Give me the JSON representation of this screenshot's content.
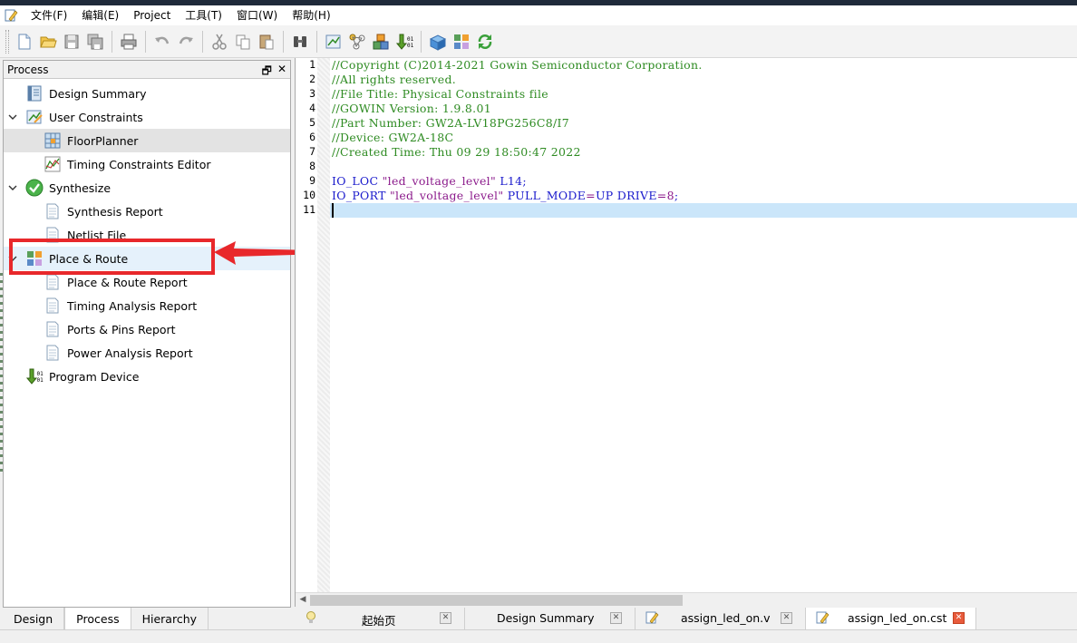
{
  "menu": {
    "items": [
      "文件(F)",
      "编辑(E)",
      "Project",
      "工具(T)",
      "窗口(W)",
      "帮助(H)"
    ]
  },
  "toolbar": {
    "buttons": [
      "new-file-icon",
      "open-folder-icon",
      "save-icon",
      "save-all-icon",
      "print-icon",
      "undo-icon",
      "redo-icon",
      "cut-icon",
      "copy-icon",
      "paste-icon",
      "find-icon",
      "constraints-icon",
      "netlist-icon",
      "synthesize-icon",
      "program-icon",
      "run-all-icon",
      "place-route-icon",
      "refresh-icon"
    ]
  },
  "process_panel": {
    "title": "Process",
    "items": [
      {
        "label": "Design Summary",
        "icon": "summary-icon",
        "level": 0,
        "expand": false
      },
      {
        "label": "User Constraints",
        "icon": "constraints-icon",
        "level": 0,
        "expand": true
      },
      {
        "label": "FloorPlanner",
        "icon": "floorplanner-icon",
        "level": 1,
        "selected": true
      },
      {
        "label": "Timing Constraints Editor",
        "icon": "timing-editor-icon",
        "level": 1
      },
      {
        "label": "Synthesize",
        "icon": "check-icon",
        "level": 0,
        "expand": true
      },
      {
        "label": "Synthesis Report",
        "icon": "report-icon",
        "level": 1
      },
      {
        "label": "Netlist File",
        "icon": "report-icon",
        "level": 1
      },
      {
        "label": "Place & Route",
        "icon": "place-route-icon",
        "level": 0,
        "expand": true,
        "hover": true
      },
      {
        "label": "Place & Route Report",
        "icon": "report-icon",
        "level": 1
      },
      {
        "label": "Timing Analysis Report",
        "icon": "report-icon",
        "level": 1
      },
      {
        "label": "Ports & Pins Report",
        "icon": "report-icon",
        "level": 1
      },
      {
        "label": "Power Analysis Report",
        "icon": "report-icon",
        "level": 1
      },
      {
        "label": "Program Device",
        "icon": "program-icon",
        "level": 0
      }
    ]
  },
  "editor": {
    "lines": [
      {
        "num": "1",
        "parts": [
          {
            "t": "//Copyright (C)2014-2021 Gowin Semiconductor Corporation.",
            "c": "comment"
          }
        ]
      },
      {
        "num": "2",
        "parts": [
          {
            "t": "//All rights reserved.",
            "c": "comment"
          }
        ]
      },
      {
        "num": "3",
        "parts": [
          {
            "t": "//File Title: Physical Constraints file",
            "c": "comment"
          }
        ]
      },
      {
        "num": "4",
        "parts": [
          {
            "t": "//GOWIN Version: 1.9.8.01",
            "c": "comment"
          }
        ]
      },
      {
        "num": "5",
        "parts": [
          {
            "t": "//Part Number: GW2A-LV18PG256C8/I7",
            "c": "comment"
          }
        ]
      },
      {
        "num": "6",
        "parts": [
          {
            "t": "//Device: GW2A-18C",
            "c": "comment"
          }
        ]
      },
      {
        "num": "7",
        "parts": [
          {
            "t": "//Created Time: Thu 09 29 18:50:47 2022",
            "c": "comment"
          }
        ]
      },
      {
        "num": "8",
        "parts": []
      },
      {
        "num": "9",
        "parts": [
          {
            "t": "IO_LOC ",
            "c": "kw"
          },
          {
            "t": "\"led_voltage_level\"",
            "c": "str"
          },
          {
            "t": " L14;",
            "c": "kw"
          }
        ]
      },
      {
        "num": "10",
        "parts": [
          {
            "t": "IO_PORT ",
            "c": "kw"
          },
          {
            "t": "\"led_voltage_level\"",
            "c": "str"
          },
          {
            "t": " PULL_MODE",
            "c": "kw"
          },
          {
            "t": "=",
            "c": "val"
          },
          {
            "t": "UP DRIVE",
            "c": "kw"
          },
          {
            "t": "=",
            "c": "val"
          },
          {
            "t": "8",
            "c": "val"
          },
          {
            "t": ";",
            "c": "kw"
          }
        ]
      },
      {
        "num": "11",
        "parts": []
      }
    ]
  },
  "left_tabs": {
    "design": "Design",
    "process": "Process",
    "hierarchy": "Hierarchy"
  },
  "doc_tabs": [
    {
      "label": "起始页",
      "icon": "bulb-icon"
    },
    {
      "label": "Design Summary",
      "icon": ""
    },
    {
      "label": "assign_led_on.v",
      "icon": "edit-file-icon"
    },
    {
      "label": "assign_led_on.cst",
      "icon": "edit-file-icon",
      "active": true
    }
  ]
}
